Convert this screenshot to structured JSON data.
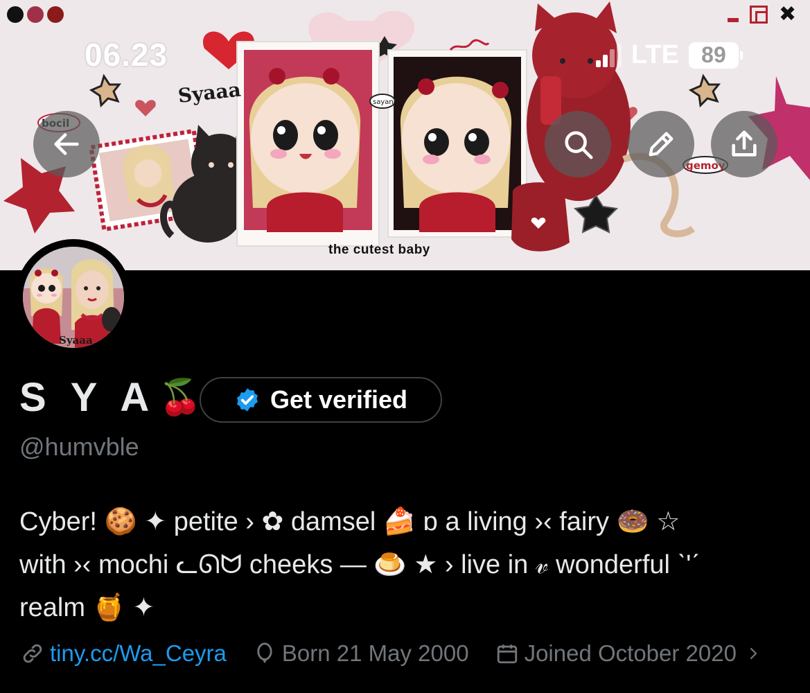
{
  "status_bar": {
    "time": "06.23",
    "network": "LTE",
    "battery": "89"
  },
  "window_controls": {
    "dot_colors": [
      "#111111",
      "#a0304a",
      "#8b1a1a"
    ],
    "icons": [
      "minimize-icon",
      "restore-icon",
      "close-icon"
    ]
  },
  "banner": {
    "caption": "the cutest baby",
    "stickers": [
      "Syaaa",
      "bocil",
      "sayang",
      "gemoy"
    ]
  },
  "toolbar": {
    "back_icon": "arrow-left-icon",
    "search_icon": "search-icon",
    "edit_icon": "pencil-icon",
    "share_icon": "share-icon"
  },
  "avatar": {
    "signature": "Syaaa"
  },
  "profile": {
    "display_name": "S Y A",
    "emoji": "🍒",
    "verify_label": "Get verified",
    "handle": "@humvble",
    "bio_lines": [
      "Cyber! 🍪 ✦ petite › ✿ damsel 🍰 ɒ a living ›‹ fairy 🍩 ☆",
      "with ›‹ mochi ᓚᘏᗢ cheeks — 🍮 ★ › live in 𝓋 wonderful ˋ'ˊ",
      "realm 🍯 ✦"
    ],
    "link": "tiny.cc/Wa_Ceyra",
    "birthday": "Born 21 May 2000",
    "joined": "Joined October 2020"
  },
  "colors": {
    "accent": "#1d9bf0",
    "muted": "#71767b",
    "text": "#e7e9ea",
    "background": "#000000"
  }
}
